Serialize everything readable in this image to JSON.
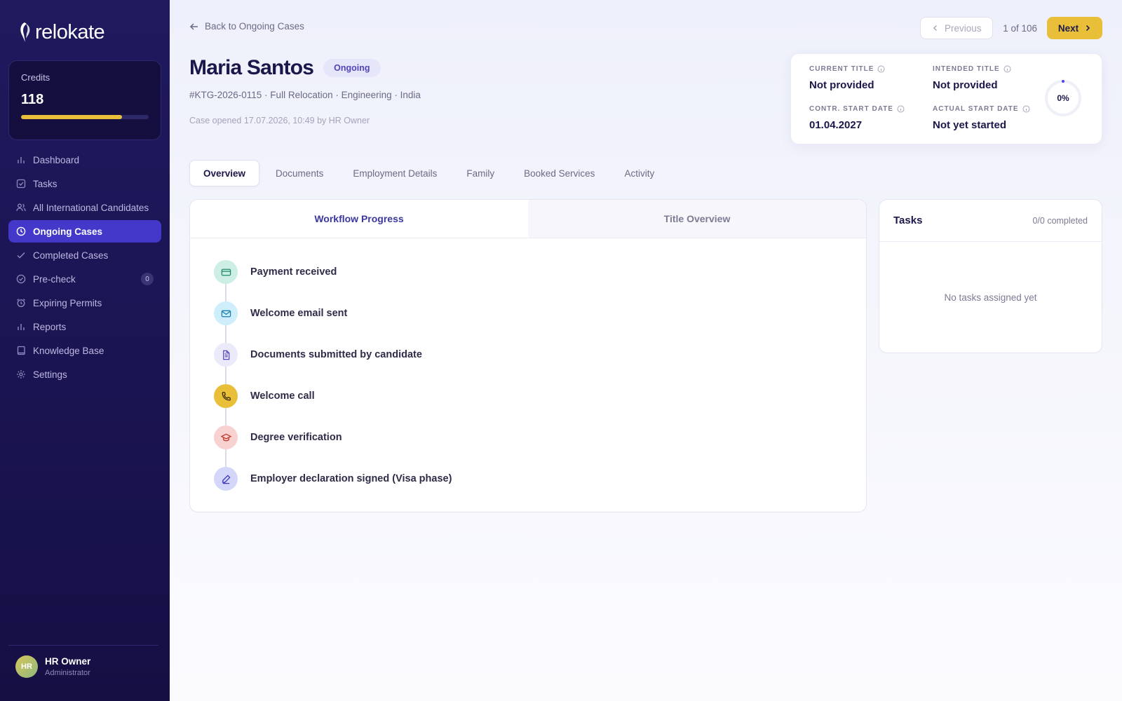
{
  "app": {
    "brand": "relokate"
  },
  "credits": {
    "label": "Credits",
    "value": "118",
    "fill_fraction": 0.79,
    "bar_color": "#e9bf3a"
  },
  "nav": {
    "items": [
      {
        "label": "Dashboard",
        "icon": "bar-chart-icon"
      },
      {
        "label": "Tasks",
        "icon": "checkbox-icon"
      },
      {
        "label": "All International Candidates",
        "icon": "users-icon"
      },
      {
        "label": "Ongoing Cases",
        "icon": "clock-icon",
        "active": true
      },
      {
        "label": "Completed Cases",
        "icon": "check-icon"
      },
      {
        "label": "Pre-check",
        "icon": "check-circle-icon",
        "badge": "0"
      },
      {
        "label": "Expiring Permits",
        "icon": "alarm-icon"
      },
      {
        "label": "Reports",
        "icon": "bar-chart-icon"
      },
      {
        "label": "Knowledge Base",
        "icon": "book-icon"
      },
      {
        "label": "Settings",
        "icon": "gear-icon"
      }
    ]
  },
  "user": {
    "initials": "HR",
    "name": "HR Owner",
    "role": "Administrator"
  },
  "header": {
    "back_label": "Back to Ongoing Cases",
    "prev_label": "Previous",
    "pager_count": "1 of 106",
    "next_label": "Next"
  },
  "case": {
    "name": "Maria Santos",
    "status": "Ongoing",
    "meta": "#KTG-2026-0115 · Full Relocation · Engineering · India",
    "opened": "Case opened 17.07.2026, 10:49 by HR Owner"
  },
  "info": {
    "current_title_label": "CURRENT TITLE",
    "current_title_value": "Not provided",
    "intended_title_label": "INTENDED TITLE",
    "intended_title_value": "Not provided",
    "contr_start_label": "CONTR. START DATE",
    "contr_start_value": "01.04.2027",
    "actual_start_label": "ACTUAL START DATE",
    "actual_start_value": "Not yet started",
    "progress_label": "0%",
    "progress_fraction": 0
  },
  "tabs": [
    {
      "label": "Overview",
      "active": true
    },
    {
      "label": "Documents"
    },
    {
      "label": "Employment Details"
    },
    {
      "label": "Family"
    },
    {
      "label": "Booked Services"
    },
    {
      "label": "Activity"
    }
  ],
  "workflow": {
    "tab_progress": "Workflow Progress",
    "tab_title": "Title Overview",
    "steps": [
      {
        "label": "Payment received",
        "icon": "credit-card-icon",
        "bg": "#cdeee4",
        "color": "#1f8a6a"
      },
      {
        "label": "Welcome email sent",
        "icon": "mail-icon",
        "bg": "#cfeefb",
        "color": "#1f7fae"
      },
      {
        "label": "Documents submitted by candidate",
        "icon": "document-icon",
        "bg": "#ebeafb",
        "color": "#4f46b8"
      },
      {
        "label": "Welcome call",
        "icon": "phone-icon",
        "bg": "#e9bf3a",
        "color": "#3a2f0a"
      },
      {
        "label": "Degree verification",
        "icon": "graduation-cap-icon",
        "bg": "#f8d1d1",
        "color": "#c0392b"
      },
      {
        "label": "Employer declaration signed (Visa phase)",
        "icon": "pen-icon",
        "bg": "#d5d7fa",
        "color": "#3b37c0"
      }
    ]
  },
  "tasks": {
    "title": "Tasks",
    "count": "0/0 completed",
    "empty": "No tasks assigned yet"
  }
}
